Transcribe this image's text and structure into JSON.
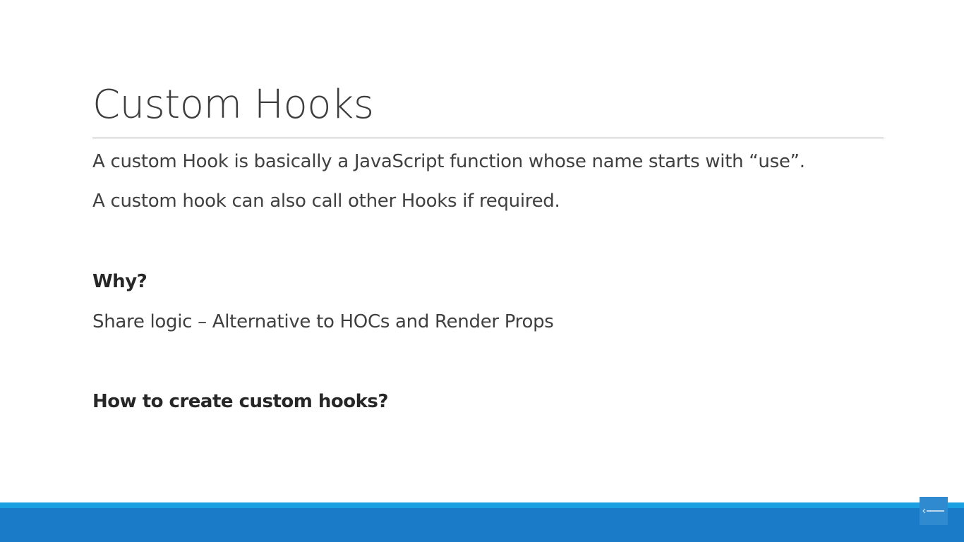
{
  "slide": {
    "title": "Custom Hooks",
    "lines": [
      "A custom Hook is basically a JavaScript function whose name starts with “use”.",
      "A custom hook can also call other Hooks if required."
    ],
    "why_heading": "Why?",
    "why_text": "Share logic – Alternative to HOCs and Render Props",
    "how_heading": "How to create custom hooks?"
  },
  "footer": {
    "accent_color": "#1ba1e2",
    "bar_color": "#1a7cc8",
    "corner_icon": "codevolution-logo-icon"
  }
}
